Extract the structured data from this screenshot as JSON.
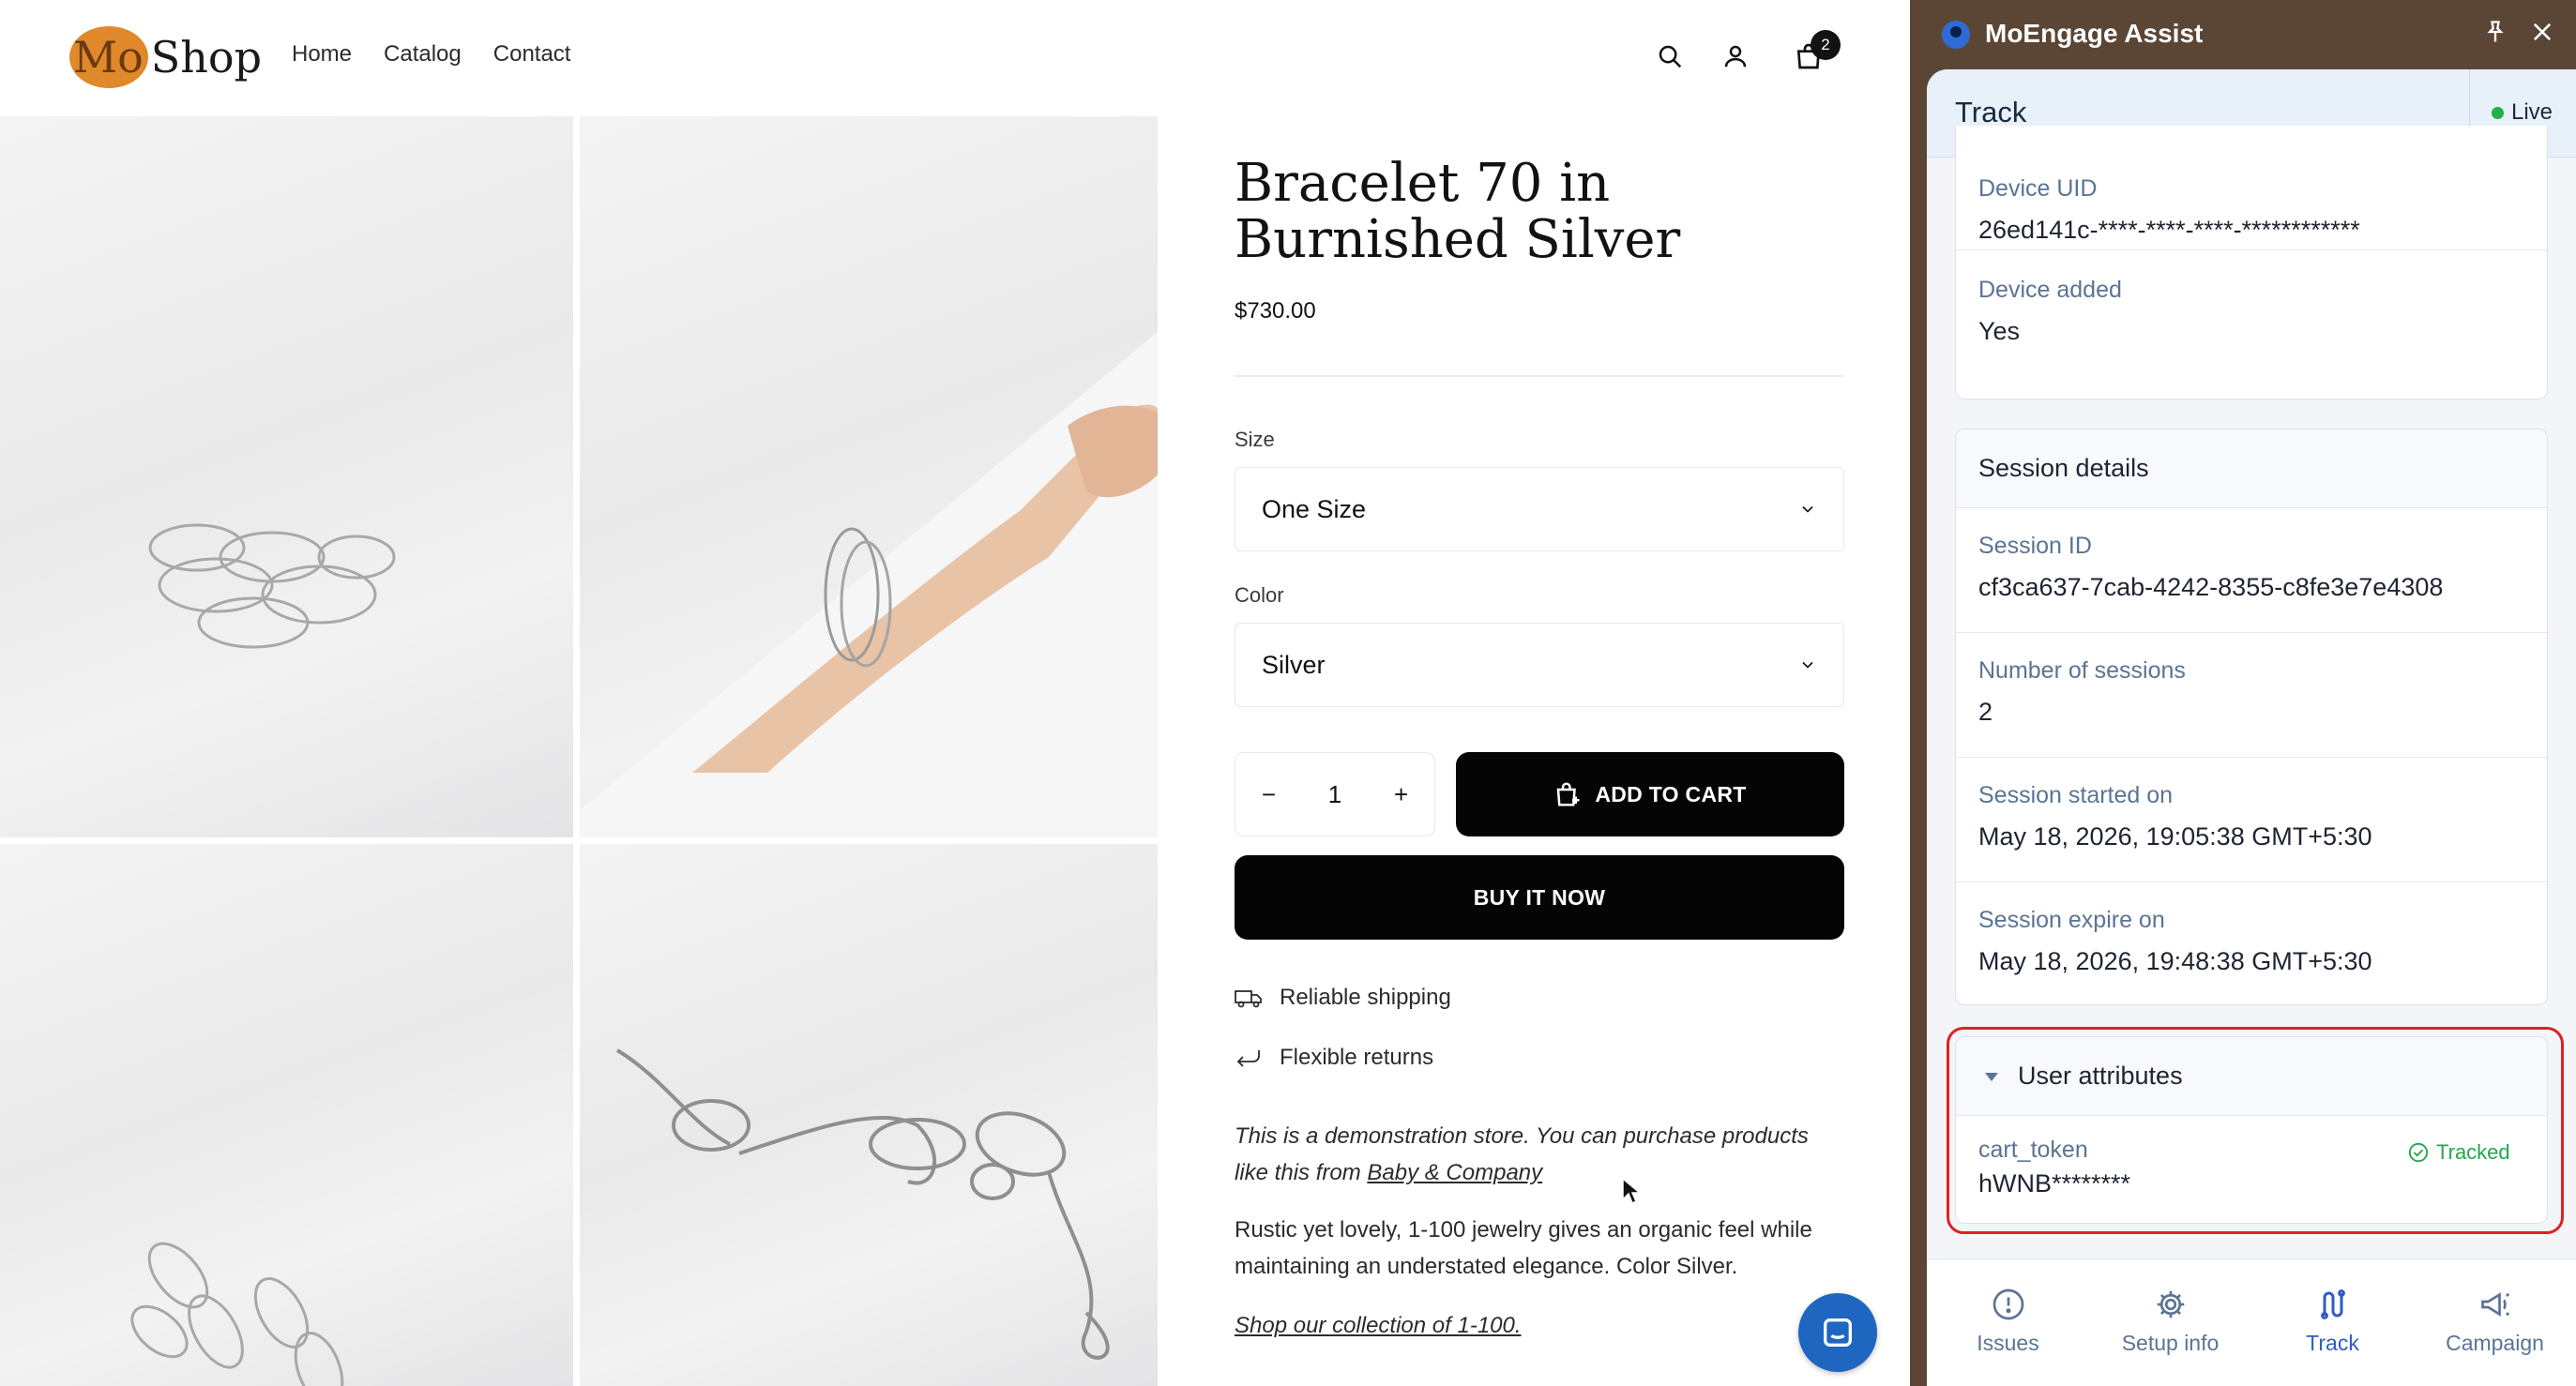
{
  "shop": {
    "logo": {
      "mo": "Mo",
      "shop": "Shop"
    },
    "nav": [
      "Home",
      "Catalog",
      "Contact"
    ],
    "cart_count": "2",
    "product": {
      "title_line1": "Bracelet 70 in",
      "title_line2": "Burnished Silver",
      "price": "$730.00",
      "size_label": "Size",
      "size_value": "One Size",
      "color_label": "Color",
      "color_value": "Silver",
      "qty_minus": "−",
      "qty_value": "1",
      "qty_plus": "+",
      "add_to_cart": "ADD TO CART",
      "buy_now": "BUY IT NOW",
      "perk_shipping": "Reliable shipping",
      "perk_returns": "Flexible returns",
      "demo_text": "This is a demonstration store. You can purchase products like this from ",
      "demo_link": "Baby & Company",
      "description": "Rustic yet lovely, 1-100 jewelry gives an organic feel while maintaining an understated elegance. Color Silver.",
      "collection_link": "Shop our collection of 1-100."
    }
  },
  "assist": {
    "title": "MoEngage Assist",
    "section": "Track",
    "status": "Live",
    "device": [
      {
        "key": "Device UID",
        "value": "26ed141c-****-****-****-************"
      },
      {
        "key": "Device added",
        "value": "Yes"
      }
    ],
    "session": {
      "heading": "Session details",
      "rows": [
        {
          "key": "Session ID",
          "value": "cf3ca637-7cab-4242-8355-c8fe3e7e4308"
        },
        {
          "key": "Number of sessions",
          "value": "2"
        },
        {
          "key": "Session started on",
          "value": "May 18, 2026, 19:05:38 GMT+5:30"
        },
        {
          "key": "Session expire on",
          "value": "May 18, 2026, 19:48:38 GMT+5:30"
        }
      ]
    },
    "user_attributes": {
      "heading": "User attributes",
      "key": "cart_token",
      "value": "hWNB********",
      "status": "Tracked"
    },
    "tabs": [
      {
        "label": "Issues",
        "icon": "alert-circle-icon"
      },
      {
        "label": "Setup info",
        "icon": "gear-icon"
      },
      {
        "label": "Track",
        "icon": "track-icon"
      },
      {
        "label": "Campaign",
        "icon": "megaphone-icon"
      }
    ],
    "colors": {
      "accent": "#2f5cc2",
      "live": "#21b04b",
      "tracked": "#21a84a",
      "highlight": "#e02020",
      "panel_frame": "#5b4636"
    }
  }
}
